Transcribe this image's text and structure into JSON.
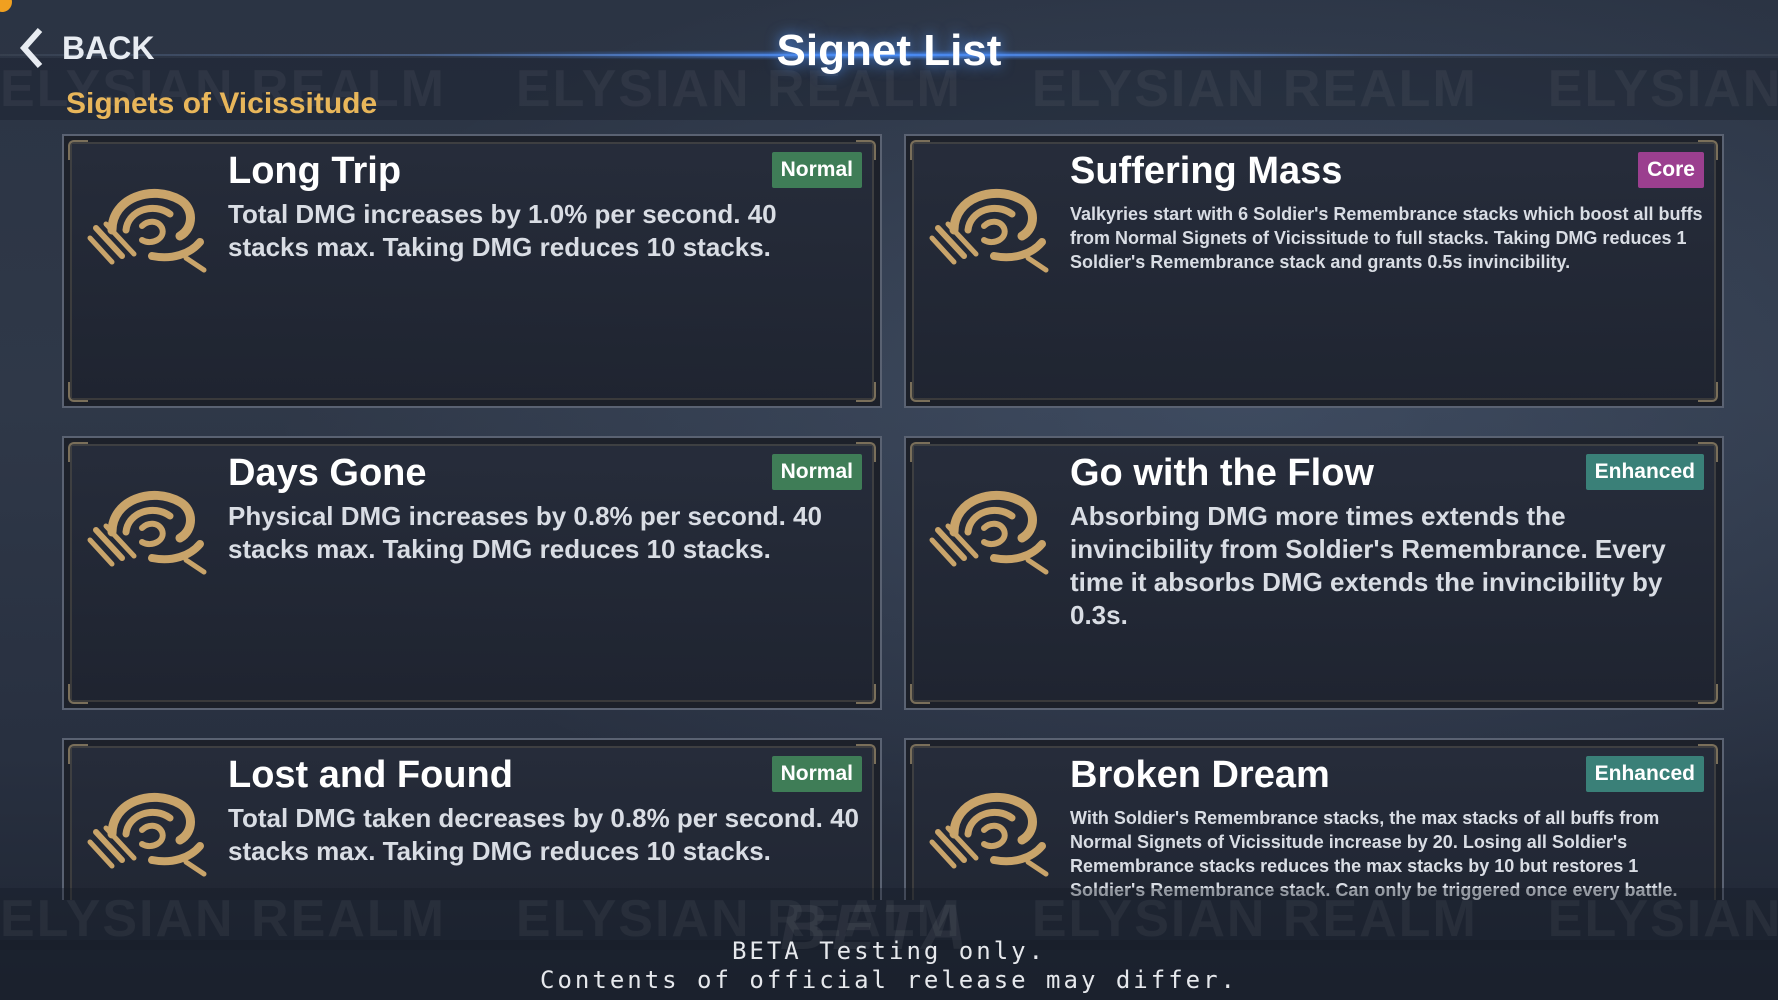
{
  "header": {
    "back_label": "BACK",
    "title": "Signet List"
  },
  "watermark_text": "ELYSIAN REALM",
  "section_heading": "Signets of Vicissitude",
  "colors": {
    "badge_normal": "#3f7d57",
    "badge_core": "#9b3f8f",
    "badge_enhanced": "#3a8078",
    "section_heading": "#e8b65a",
    "emblem_gold": "#c9a46a"
  },
  "cards": [
    {
      "title": "Long Trip",
      "badge": "Normal",
      "description": "Total DMG increases by 1.0% per second. 40 stacks max. Taking DMG reduces 10 stacks.",
      "icon": "vicissitude-emblem-icon"
    },
    {
      "title": "Suffering Mass",
      "badge": "Core",
      "description": "Valkyries start with 6 Soldier's Remembrance stacks which boost all buffs from Normal Signets of Vicissitude to full stacks. Taking DMG reduces 1 Soldier's Remembrance stack and grants 0.5s invincibility.",
      "icon": "vicissitude-emblem-icon"
    },
    {
      "title": "Days Gone",
      "badge": "Normal",
      "description": "Physical DMG increases by 0.8% per second. 40 stacks max. Taking DMG reduces 10 stacks.",
      "icon": "vicissitude-emblem-icon"
    },
    {
      "title": "Go with the Flow",
      "badge": "Enhanced",
      "description": "Absorbing DMG more times extends the invincibility from Soldier's Remembrance. Every time it absorbs DMG extends the invincibility by 0.3s.",
      "icon": "vicissitude-emblem-icon"
    },
    {
      "title": "Lost and Found",
      "badge": "Normal",
      "description": "Total DMG taken decreases by 0.8% per second. 40 stacks max. Taking DMG reduces 10 stacks.",
      "icon": "vicissitude-emblem-icon"
    },
    {
      "title": "Broken Dream",
      "badge": "Enhanced",
      "description": "With Soldier's Remembrance stacks, the max stacks of all buffs from Normal Signets of Vicissitude increase by 20. Losing all Soldier's Remembrance stacks reduces the max stacks by 10 but restores 1 Soldier's Remembrance stack. Can only be triggered once every battle.",
      "icon": "vicissitude-emblem-icon"
    }
  ],
  "footer": {
    "watermark": "BETA",
    "line1": "BETA Testing only.",
    "line2": "Contents of official release may differ."
  }
}
